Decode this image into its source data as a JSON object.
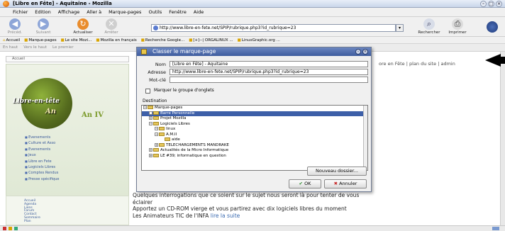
{
  "window": {
    "title": "[Libre en Fête] - Aquitaine - Mozilla"
  },
  "menu": [
    "Fichier",
    "Edition",
    "Affichage",
    "Aller à",
    "Marque-pages",
    "Outils",
    "Fenêtre",
    "Aide"
  ],
  "nav": {
    "back": "Précéd.",
    "forward": "Suivant",
    "reload": "Actualiser",
    "stop": "Arrêter",
    "search": "Rechercher",
    "print": "Imprimer"
  },
  "url": "http://www.libre-en-fete.net/SPIP/rubrique.php3?id_rubrique=23",
  "bookmarks": [
    "Accueil",
    "Marque-pages",
    "Le site Mozi...",
    "Mozilla en français",
    "Recherche Google...",
    "[+]--| ORGALINUX ...",
    "LinuxGraphic.org ..."
  ],
  "tabs": [
    "En haut",
    "Vers le haut",
    "Le premier"
  ],
  "site": {
    "header_path": "Accueil",
    "top_links": "ore en Fête | plan du site | admin",
    "logo_text": "Libre-en-tête",
    "logo_an": "An",
    "an_iv": "An IV",
    "menu": [
      "Evenements",
      "Culture et Asso",
      "Evenements",
      "Jeux",
      "Libre en Fete",
      "Logiciels Libres",
      "Comptes Rendus",
      "Presse spécifique"
    ],
    "menu2": [
      "Accueil",
      "Agenda",
      "Liens",
      "Forum",
      "Contact",
      "Sommaire",
      "Plan"
    ],
    "main_text_1": "Quelques interrogations que ce soient sur le sujet nous seront là pour tenter de vous éclairer",
    "main_text_2": "Apportez un CD-ROM vierge et vous partirez avec dix logiciels libres du moment",
    "main_text_3": "Les Animateurs TIC de l'INFA",
    "main_text_link": "lire la suite"
  },
  "dialog": {
    "title": "Classer le marque-page",
    "name_label": "Nom",
    "name_value": "[Libre en Fête] - Aquitaine",
    "address_label": "Adresse",
    "address_value": "http://www.libre-en-fete.net/SPIP/rubrique.php3?id_rubrique=23",
    "keyword_label": "Mot-clé",
    "keyword_value": "",
    "checkbox_label": "Marquer le groupe d'onglets",
    "dest_label": "Destination",
    "tree": [
      {
        "label": "Marque-pages",
        "level": 0,
        "exp": "-",
        "selected": false
      },
      {
        "label": "Barre Personnelle",
        "level": 1,
        "exp": "+",
        "selected": true
      },
      {
        "label": "Projet Mozilla",
        "level": 1,
        "exp": "+",
        "selected": false
      },
      {
        "label": "Logiciels Libres",
        "level": 1,
        "exp": "-",
        "selected": false
      },
      {
        "label": "linux",
        "level": 2,
        "exp": "-",
        "selected": false
      },
      {
        "label": "A.M.II",
        "level": 2,
        "exp": "-",
        "selected": false
      },
      {
        "label": "aide",
        "level": 3,
        "exp": "",
        "selected": false
      },
      {
        "label": "TELECHARGEMENTS MANDRAKE",
        "level": 2,
        "exp": "+",
        "selected": false
      },
      {
        "label": "Actualités de la Micro Informatique",
        "level": 1,
        "exp": "+",
        "selected": false
      },
      {
        "label": "LE #39; informatique en question",
        "level": 1,
        "exp": "+",
        "selected": false
      }
    ],
    "new_folder": "Nouveau dossier...",
    "ok": "OK",
    "cancel": "Annuler"
  }
}
